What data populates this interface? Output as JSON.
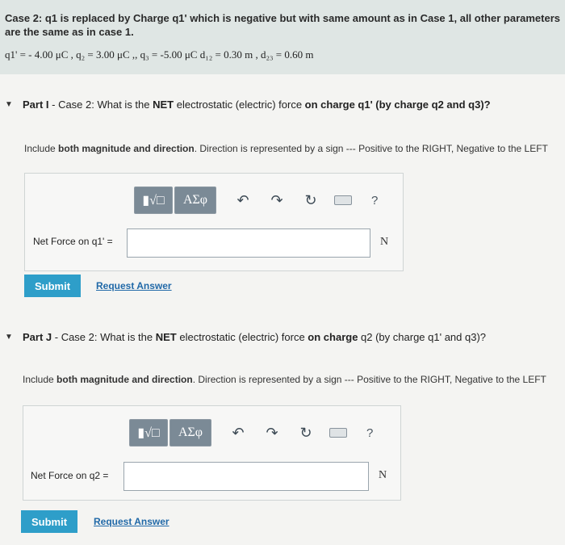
{
  "case": {
    "title": "Case 2:   q1 is replaced by Charge q1' which is negative but with same amount as in Case 1, all other parameters are the same as in case 1.",
    "params": "q1' = - 4.00 μC , q₂ = 3.00 μC ,, q₃ = -5.00 μC    d₁₂ = 0.30 m , d₂₃ = 0.60 m"
  },
  "part_i": {
    "label": "Part I",
    "question_prefix": " - Case 2: What is the ",
    "question_strong": "NET",
    "question_mid": " electrostatic (electric) force ",
    "question_strong2": "on charge q1' (by charge q2 and q3)?",
    "instr_prefix": "Include ",
    "instr_strong": "both magnitude and direction",
    "instr_suffix": ". Direction is represented by a sign  --- Positive to the RIGHT, Negative to the LEFT",
    "field_label": "Net Force on q1' =",
    "unit": "N",
    "submit": "Submit",
    "request": "Request Answer"
  },
  "part_j": {
    "label": "Part J",
    "question_prefix": " - Case 2: What is the ",
    "question_strong": "NET",
    "question_mid": " electrostatic (electric) force ",
    "question_strong2": "on charge",
    "question_suffix": " q2  (by charge q1' and q3)?",
    "instr_prefix": "Include ",
    "instr_strong": "both magnitude and direction",
    "instr_suffix": ". Direction is represented by a sign  --- Positive to the RIGHT, Negative to the LEFT",
    "field_label": "Net Force on q2 =",
    "unit": "N",
    "submit": "Submit",
    "request": "Request Answer"
  },
  "toolbar": {
    "template_label": "▮√□",
    "greek_label": "ΑΣφ",
    "undo": "↶",
    "redo": "↷",
    "reset": "↻",
    "help": "?"
  }
}
